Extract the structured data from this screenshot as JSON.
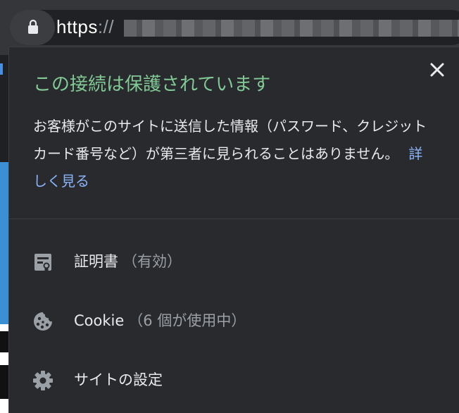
{
  "address_bar": {
    "scheme": "https",
    "separator": "://"
  },
  "popup": {
    "title": "この接続は保護されています",
    "description": "お客様がこのサイトに送信した情報（パスワード、クレジット カード番号など）が第三者に見られることはありません。",
    "learn_more": "詳しく見る",
    "items": [
      {
        "label": "証明書",
        "detail": "（有効）",
        "icon": "certificate-icon"
      },
      {
        "label": "Cookie",
        "detail": "（6 個が使用中）",
        "icon": "cookie-icon"
      },
      {
        "label": "サイトの設定",
        "detail": "",
        "icon": "gear-icon"
      }
    ]
  },
  "colors": {
    "title_green": "#81c995",
    "link_blue": "#8ab4f8",
    "popup_bg": "#292a2d",
    "text": "#e8eaed",
    "muted": "#9aa0a6"
  }
}
